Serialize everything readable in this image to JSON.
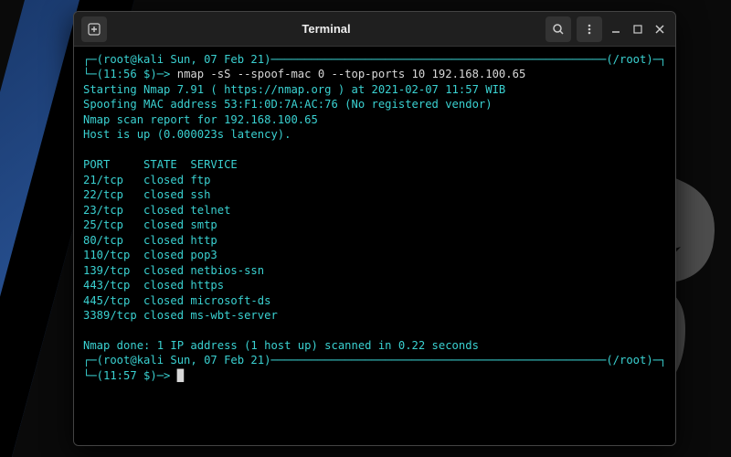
{
  "window": {
    "title": "Terminal"
  },
  "prompt1": {
    "userhost": "root@kali",
    "date": "Sun, 07 Feb 21",
    "path": "/root",
    "time_marker": "11:56 $",
    "command": "nmap -sS --spoof-mac 0 --top-ports 10 192.168.100.65"
  },
  "output": {
    "starting": "Starting Nmap 7.91 ( https://nmap.org ) at 2021-02-07 11:57 WIB",
    "spoofing": "Spoofing MAC address 53:F1:0D:7A:AC:76 (No registered vendor)",
    "report": "Nmap scan report for 192.168.100.65",
    "host": "Host is up (0.000023s latency).",
    "header_port": "PORT",
    "header_state": "STATE",
    "header_service": "SERVICE",
    "rows": [
      {
        "port": "21/tcp",
        "state": "closed",
        "service": "ftp"
      },
      {
        "port": "22/tcp",
        "state": "closed",
        "service": "ssh"
      },
      {
        "port": "23/tcp",
        "state": "closed",
        "service": "telnet"
      },
      {
        "port": "25/tcp",
        "state": "closed",
        "service": "smtp"
      },
      {
        "port": "80/tcp",
        "state": "closed",
        "service": "http"
      },
      {
        "port": "110/tcp",
        "state": "closed",
        "service": "pop3"
      },
      {
        "port": "139/tcp",
        "state": "closed",
        "service": "netbios-ssn"
      },
      {
        "port": "443/tcp",
        "state": "closed",
        "service": "https"
      },
      {
        "port": "445/tcp",
        "state": "closed",
        "service": "microsoft-ds"
      },
      {
        "port": "3389/tcp",
        "state": "closed",
        "service": "ms-wbt-server"
      }
    ],
    "done": "Nmap done: 1 IP address (1 host up) scanned in 0.22 seconds"
  },
  "prompt2": {
    "userhost": "root@kali",
    "date": "Sun, 07 Feb 21",
    "path": "/root",
    "time_marker": "11:57 $"
  }
}
